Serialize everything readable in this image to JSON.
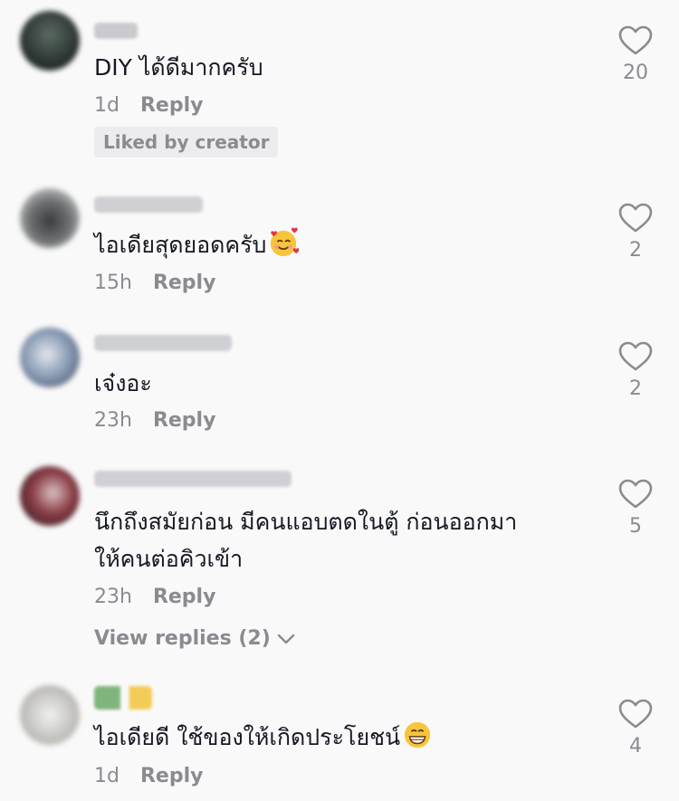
{
  "comments": [
    {
      "text": "DIY ได้ดีมากครับ",
      "time": "1d",
      "reply_label": "Reply",
      "badge": "Liked by creator",
      "likes": "20"
    },
    {
      "text": "ไอเดียสุดยอดครับ",
      "emoji": "smiling-face-with-hearts",
      "time": "15h",
      "reply_label": "Reply",
      "likes": "2"
    },
    {
      "text": "เจ๋งอะ",
      "time": "23h",
      "reply_label": "Reply",
      "likes": "2"
    },
    {
      "text_line1": "นึกถึงสมัยก่อน มีคนแอบตดในตู้ ก่อนออกมา",
      "text_line2": "ให้คนต่อคิวเข้า",
      "time": "23h",
      "reply_label": "Reply",
      "likes": "5",
      "view_replies": "View replies (2)"
    },
    {
      "text": "ไอเดียดี ใช้ของให้เกิดประโยชน์",
      "emoji": "grinning-face",
      "time": "1d",
      "reply_label": "Reply",
      "likes": "4"
    }
  ],
  "icons": {
    "like": "heart-outline-icon",
    "expand": "chevron-down-icon"
  },
  "colors": {
    "background": "#f9f9f9",
    "text": "#161823",
    "secondary": "#8a8b91",
    "badge_bg": "#ececee"
  }
}
